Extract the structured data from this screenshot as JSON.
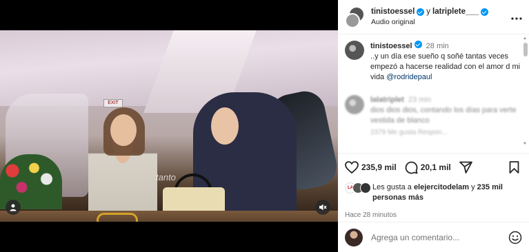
{
  "video": {
    "caption_overlay": "tanto"
  },
  "header": {
    "user1": "tinistoessel",
    "conjunction": "y",
    "user2": "latriplete___",
    "subtitle": "Audio original"
  },
  "comments": [
    {
      "user": "tinistoessel",
      "time": "28 min",
      "text": "..y un día ese sueño q soñé tantas veces empezó a hacerse realidad con el amor d mi vida ",
      "mention": "@rodridepaul"
    },
    {
      "user": "lalatriplet",
      "time": "23 min",
      "text": "dios dios dios, contando los días para verte vestida de blanco",
      "meta": "2379 Me gusta   Respon..."
    }
  ],
  "actions": {
    "likes_count": "235,9 mil",
    "comments_count": "20,1 mil"
  },
  "likes_line": {
    "prefix": "Les gusta a ",
    "user": "elejercitodelam",
    "middle": " y ",
    "others": "235 mil personas más",
    "badge": "LA"
  },
  "timestamp": "Hace 28 minutos",
  "add_comment": {
    "placeholder": "Agrega un comentario..."
  }
}
